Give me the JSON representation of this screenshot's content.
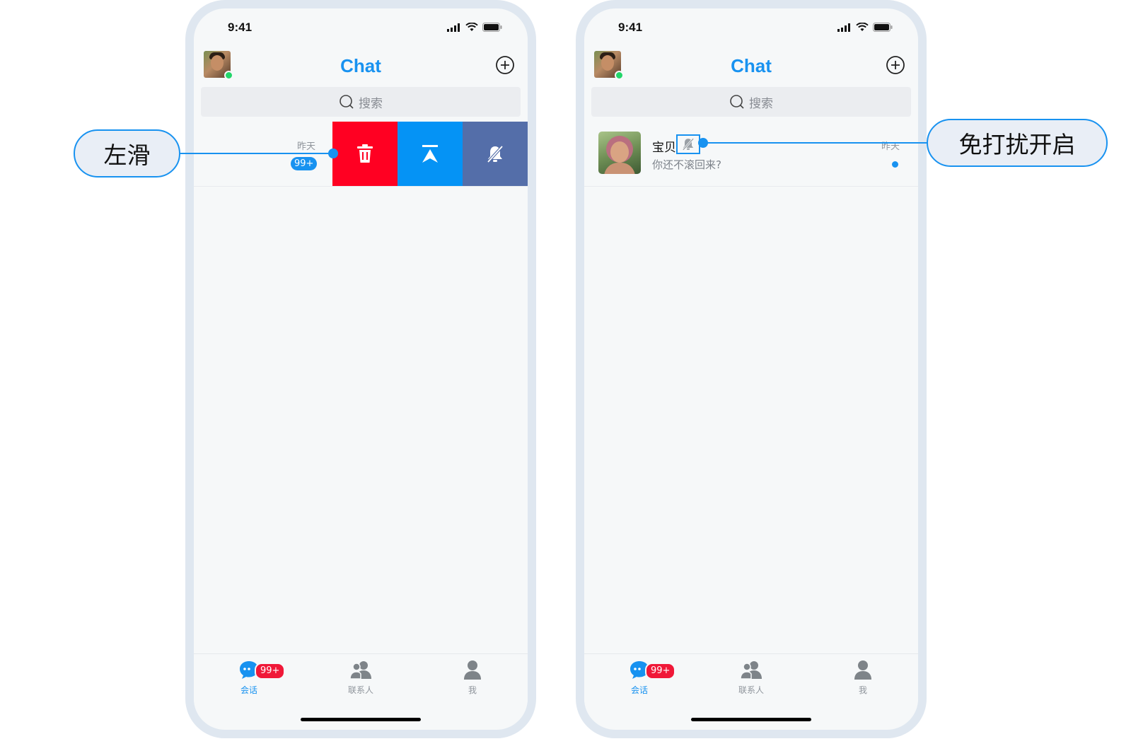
{
  "colors": {
    "accent": "#1892f0",
    "delete": "#ff0022",
    "pin": "#0593f5",
    "mute": "#546ea9",
    "badge_red": "#f01838",
    "online": "#22d66a"
  },
  "left_phone": {
    "status_time": "9:41",
    "title": "Chat",
    "search_placeholder": "搜索",
    "row": {
      "time": "昨天",
      "unread": "99+",
      "actions": [
        "delete-icon",
        "pin-to-top-icon",
        "mute-bell-icon"
      ]
    },
    "tabs": [
      {
        "label": "会话",
        "badge": "99+",
        "icon": "chat-bubble-icon",
        "active": true
      },
      {
        "label": "联系人",
        "icon": "contacts-icon"
      },
      {
        "label": "我",
        "icon": "person-icon"
      }
    ]
  },
  "right_phone": {
    "status_time": "9:41",
    "title": "Chat",
    "search_placeholder": "搜索",
    "row": {
      "name": "宝贝",
      "message": "你还不滚回来?",
      "time": "昨天",
      "muted_icon": "mute-bell-icon"
    },
    "tabs": [
      {
        "label": "会话",
        "badge": "99+",
        "icon": "chat-bubble-icon",
        "active": true
      },
      {
        "label": "联系人",
        "icon": "contacts-icon"
      },
      {
        "label": "我",
        "icon": "person-icon"
      }
    ]
  },
  "annotations": {
    "left": "左滑",
    "right": "免打扰开启"
  }
}
